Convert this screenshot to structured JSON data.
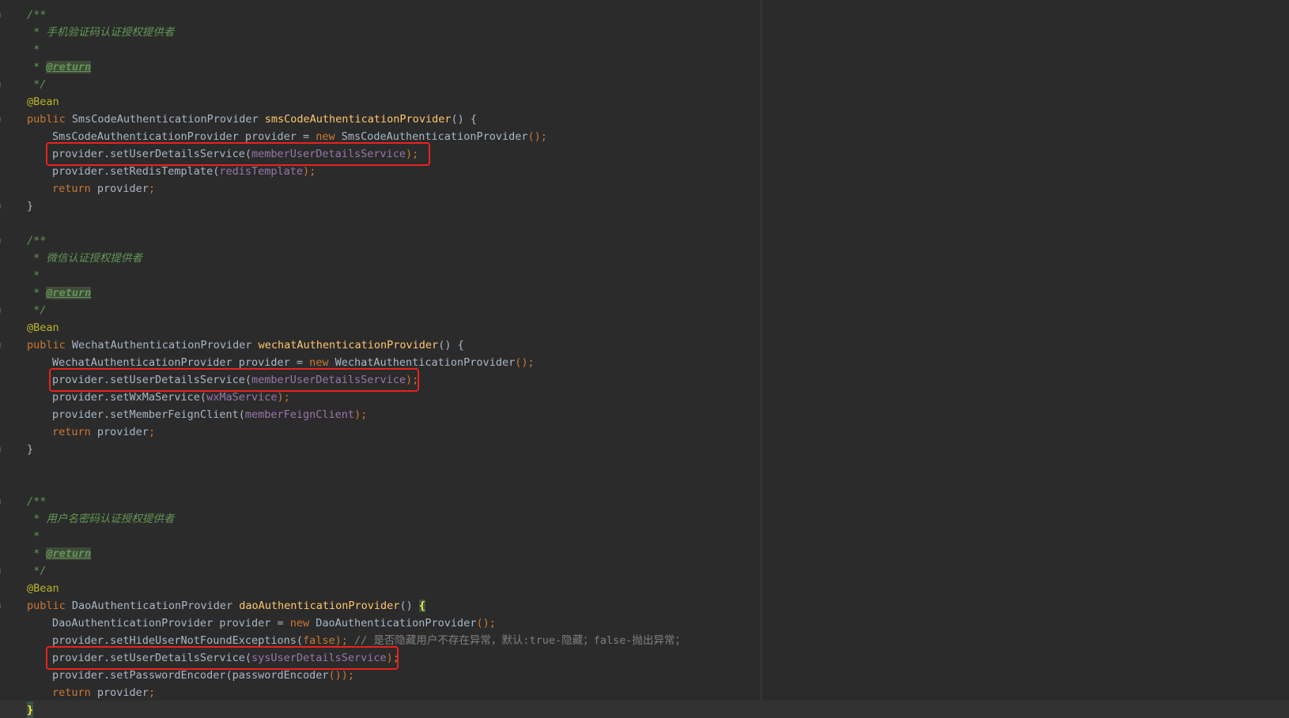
{
  "editor": {
    "language": "java",
    "colors": {
      "background": "#2b2b2b",
      "keyword": "#cc7832",
      "annotation": "#bbb529",
      "method_declaration": "#ffc66d",
      "field": "#9876aa",
      "javadoc": "#629755",
      "comment": "#808080",
      "highlight_box": "#e8231c"
    }
  },
  "block1": {
    "doc_open": "/**",
    "doc_desc": " * 手机验证码认证授权提供者",
    "doc_star": " *",
    "doc_star_prefix": " * ",
    "doc_return": "@return",
    "doc_close": " */",
    "annotation": "@Bean",
    "kw_public": "public ",
    "return_type": "SmsCodeAuthenticationProvider ",
    "method_name": "smsCodeAuthenticationProvider",
    "sig_end": "() {",
    "l1_type": "SmsCodeAuthenticationProvider provider = ",
    "l1_new": "new ",
    "l1_ctor": "SmsCodeAuthenticationProvider",
    "l1_end": "();",
    "l2_call": "provider.setUserDetailsService(",
    "l2_arg": "memberUserDetailsService",
    "l2_end": ");",
    "l3_call": "provider.setRedisTemplate(",
    "l3_arg": "redisTemplate",
    "l3_end": ");",
    "ret_kw": "return ",
    "ret_val": "provider",
    "ret_end": ";",
    "close": "}"
  },
  "block2": {
    "doc_open": "/**",
    "doc_desc": " * 微信认证授权提供者",
    "doc_star": " *",
    "doc_star_prefix": " * ",
    "doc_return": "@return",
    "doc_close": " */",
    "annotation": "@Bean",
    "kw_public": "public ",
    "return_type": "WechatAuthenticationProvider ",
    "method_name": "wechatAuthenticationProvider",
    "sig_end": "() {",
    "l1_type": "WechatAuthenticationProvider provider = ",
    "l1_new": "new ",
    "l1_ctor": "WechatAuthenticationProvider",
    "l1_end": "();",
    "l2_call": "provider.setUserDetailsService(",
    "l2_arg": "memberUserDetailsService",
    "l2_end": ");",
    "l3_call": "provider.setWxMaService(",
    "l3_arg": "wxMaService",
    "l3_end": ");",
    "l4_call": "provider.setMemberFeignClient(",
    "l4_arg": "memberFeignClient",
    "l4_end": ");",
    "ret_kw": "return ",
    "ret_val": "provider",
    "ret_end": ";",
    "close": "}"
  },
  "block3": {
    "doc_open": "/**",
    "doc_desc": " * 用户名密码认证授权提供者",
    "doc_star": " *",
    "doc_star_prefix": " * ",
    "doc_return": "@return",
    "doc_close": " */",
    "annotation": "@Bean",
    "kw_public": "public ",
    "return_type": "DaoAuthenticationProvider ",
    "method_name": "daoAuthenticationProvider",
    "sig_paren": "() ",
    "sig_brace": "{",
    "l1_type": "DaoAuthenticationProvider provider = ",
    "l1_new": "new ",
    "l1_ctor": "DaoAuthenticationProvider",
    "l1_end": "();",
    "l2_call": "provider.setHideUserNotFoundExceptions(",
    "l2_arg": "false",
    "l2_end": "); ",
    "l2_comment": "// 是否隐藏用户不存在异常，默认:true-隐藏；false-抛出异常；",
    "l3_call": "provider.setUserDetailsService(",
    "l3_arg": "sysUserDetailsService",
    "l3_end": ");",
    "l4_call": "provider.setPasswordEncoder(passwordEncoder",
    "l4_end": "());",
    "ret_kw": "return ",
    "ret_val": "provider",
    "ret_end": ";",
    "close": "}"
  }
}
